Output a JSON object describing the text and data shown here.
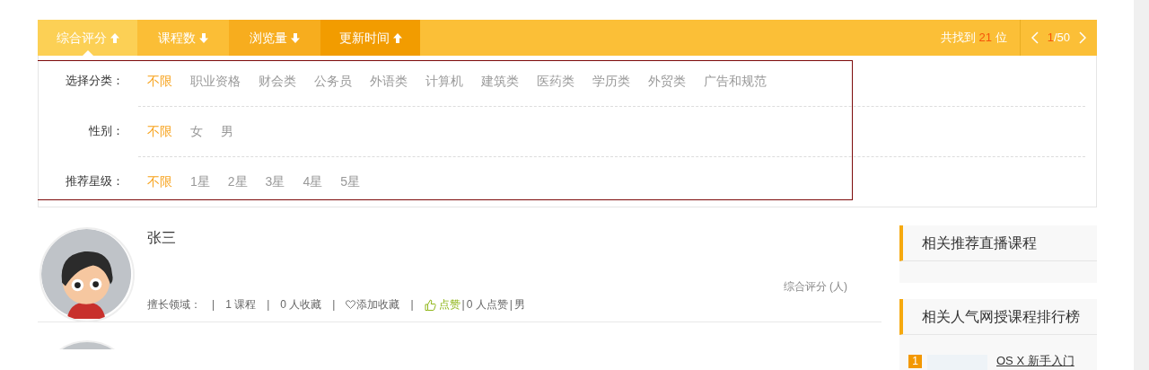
{
  "sort_tabs": [
    {
      "label": "综合评分",
      "ascending": true,
      "selected": true
    },
    {
      "label": "课程数",
      "ascending": false,
      "selected": false
    },
    {
      "label": "浏览量",
      "ascending": false,
      "selected": false
    },
    {
      "label": "更新时间",
      "ascending": true,
      "selected": false
    }
  ],
  "result_count": {
    "prefix": "共找到",
    "count": "21",
    "suffix": "位"
  },
  "pager": {
    "current": "1",
    "total": "/50"
  },
  "filters": [
    {
      "label": "选择分类：",
      "options": [
        {
          "text": "不限",
          "selected": true
        },
        {
          "text": "职业资格",
          "selected": false
        },
        {
          "text": "财会类",
          "selected": false
        },
        {
          "text": "公务员",
          "selected": false
        },
        {
          "text": "外语类",
          "selected": false
        },
        {
          "text": "计算机",
          "selected": false
        },
        {
          "text": "建筑类",
          "selected": false
        },
        {
          "text": "医药类",
          "selected": false
        },
        {
          "text": "学历类",
          "selected": false
        },
        {
          "text": "外贸类",
          "selected": false
        },
        {
          "text": "广告和规范",
          "selected": false
        }
      ]
    },
    {
      "label": "性别：",
      "options": [
        {
          "text": "不限",
          "selected": true
        },
        {
          "text": "女",
          "selected": false
        },
        {
          "text": "男",
          "selected": false
        }
      ]
    },
    {
      "label": "推荐星级：",
      "options": [
        {
          "text": "不限",
          "selected": true
        },
        {
          "text": "1星",
          "selected": false
        },
        {
          "text": "2星",
          "selected": false
        },
        {
          "text": "3星",
          "selected": false
        },
        {
          "text": "4星",
          "selected": false
        },
        {
          "text": "5星",
          "selected": false
        }
      ]
    }
  ],
  "teachers": [
    {
      "name": "张三",
      "rating_label": "综合评分 (人)",
      "stats": [
        {
          "kind": "text",
          "text": "擅长领域："
        },
        {
          "kind": "sep",
          "text": "|"
        },
        {
          "kind": "text",
          "text": "1 课程"
        },
        {
          "kind": "sep",
          "text": "|"
        },
        {
          "kind": "text",
          "text": "0 人收藏"
        },
        {
          "kind": "sep",
          "text": "|"
        },
        {
          "kind": "favorite",
          "text": "添加收藏"
        },
        {
          "kind": "sep",
          "text": "|"
        },
        {
          "kind": "like",
          "text": "点赞"
        },
        {
          "kind": "tight-sep",
          "text": "|"
        },
        {
          "kind": "text",
          "text": "0 人点赞"
        },
        {
          "kind": "tight-sep",
          "text": "|"
        },
        {
          "kind": "text",
          "text": "男"
        }
      ]
    }
  ],
  "sidebar": [
    {
      "title": "相关推荐直播课程"
    },
    {
      "title": "相关人气网授课程排行榜",
      "items": [
        {
          "rank": "1",
          "title": "OS X 新手入门"
        }
      ]
    }
  ]
}
